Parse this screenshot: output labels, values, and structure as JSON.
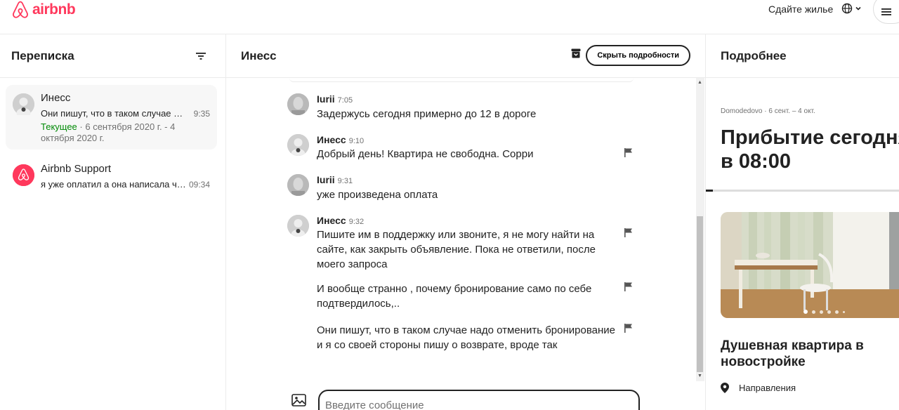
{
  "header": {
    "logo_text": "airbnb",
    "host_link": "Сдайте жилье",
    "brand_color": "#ff385c"
  },
  "inbox": {
    "title": "Переписка",
    "conversations": [
      {
        "name": "Инесс",
        "preview": "Они пишут, что в таком случае над...",
        "time": "9:35",
        "status_label": "Текущее",
        "status_dates": " · 6 сентября 2020 г. - 4 октября 2020 г."
      },
      {
        "name": "Airbnb Support",
        "preview": "я уже оплатил а она написала что ...",
        "time": "09:34"
      }
    ]
  },
  "chat": {
    "title": "Инесс",
    "hide_details_button": "Скрыть подробности",
    "messages": [
      {
        "sender": "Iurii",
        "time": "7:05",
        "texts": [
          "Задержусь сегодня примерно до 12 в дороге"
        ]
      },
      {
        "sender": "Инесс",
        "time": "9:10",
        "texts": [
          "Добрый день! Квартира не свободна. Сорри"
        ]
      },
      {
        "sender": "Iurii",
        "time": "9:31",
        "texts": [
          "уже произведена оплата"
        ]
      },
      {
        "sender": "Инесс",
        "time": "9:32",
        "texts": [
          "Пишите им в поддержку или звоните, я не могу найти на сайте, как закрыть объявление. Пока не ответили, после моего запроса",
          "И вообще странно , почему бронирование само по себе подтвердилось,..",
          "Они пишут, что в таком случае надо отменить бронирование и я со своей стороны пишу о возврате, вроде так"
        ]
      }
    ],
    "input_placeholder": "Введите сообщение"
  },
  "details": {
    "title": "Подробнее",
    "trip_meta": "Domodedovo · 6 сент. – 4 окт.",
    "trip_title_line1": "Прибытие сегодня",
    "trip_title_line2": "в 08:00",
    "listing_title": "Душевная квартира в новостройке",
    "directions_label": "Направления"
  },
  "icons": {
    "logo": "airbnb-logo-icon",
    "globe": "globe-icon",
    "menu": "hamburger-menu-icon",
    "filter": "filter-icon",
    "archive": "archive-icon",
    "flag": "flag-icon",
    "image": "image-upload-icon",
    "pin": "location-pin-icon"
  }
}
